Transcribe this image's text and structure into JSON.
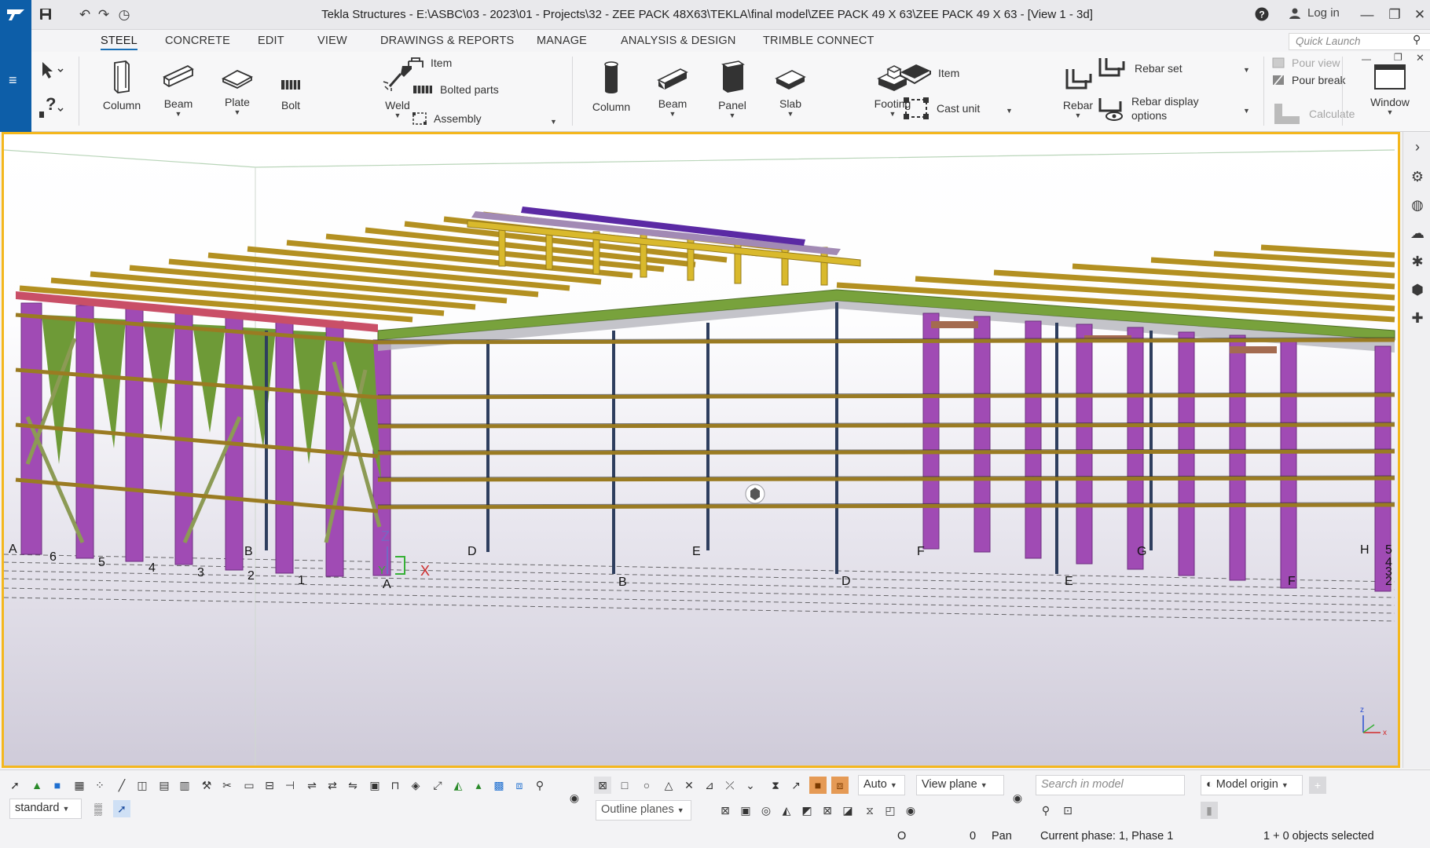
{
  "title_bar": {
    "title": "Tekla Structures - E:\\ASBC\\03 - 2023\\01 - Projects\\32 - ZEE PACK 48X63\\TEKLA\\final model\\ZEE PACK 49 X 63\\ZEE PACK 49 X 63  - [View 1 - 3d]",
    "login_label": "Log in",
    "help_label": "?"
  },
  "menu_tabs": [
    {
      "label": "STEEL",
      "active": true
    },
    {
      "label": "CONCRETE"
    },
    {
      "label": "EDIT"
    },
    {
      "label": "VIEW"
    },
    {
      "label": "DRAWINGS & REPORTS"
    },
    {
      "label": "MANAGE"
    },
    {
      "label": "ANALYSIS & DESIGN"
    },
    {
      "label": "TRIMBLE CONNECT"
    }
  ],
  "quick_launch": {
    "placeholder": "Quick Launch"
  },
  "ribbon": {
    "steel": {
      "column": "Column",
      "beam": "Beam",
      "plate": "Plate",
      "bolt": "Bolt",
      "weld": "Weld",
      "item": "Item",
      "bolted_parts": "Bolted parts",
      "assembly": "Assembly"
    },
    "concrete": {
      "column": "Column",
      "beam": "Beam",
      "panel": "Panel",
      "slab": "Slab",
      "footing": "Footing",
      "item": "Item",
      "cast_unit": "Cast unit",
      "rebar": "Rebar",
      "rebar_set": "Rebar set",
      "rebar_display_options_1": "Rebar display",
      "rebar_display_options_2": "options",
      "pour_view": "Pour view",
      "pour_break": "Pour break",
      "calculate": "Calculate"
    },
    "window": "Window"
  },
  "viewport": {
    "grid_labels_left": [
      "A",
      "6",
      "5",
      "4",
      "3",
      "2",
      "1",
      "B"
    ],
    "grid_labels_front": [
      "A",
      "B",
      "D",
      "E",
      "F",
      "D",
      "E",
      "F",
      "G",
      "H"
    ],
    "grid_labels_right": [
      "5",
      "4",
      "3",
      "2"
    ],
    "axis": {
      "z": "Z",
      "y": "Y",
      "x": "X"
    },
    "mini_axis": {
      "z": "z",
      "x": "x"
    }
  },
  "bottom": {
    "filter_select": "standard",
    "depth_select": "Auto",
    "plane_select": "View plane",
    "outline_select": "Outline planes",
    "search_placeholder": "Search in model",
    "origin_select": "Model origin",
    "status_o": "O",
    "status_zero": "0",
    "status_pan": "Pan",
    "status_phase": "Current phase: 1, Phase 1",
    "status_selected": "1 + 0 objects selected"
  }
}
